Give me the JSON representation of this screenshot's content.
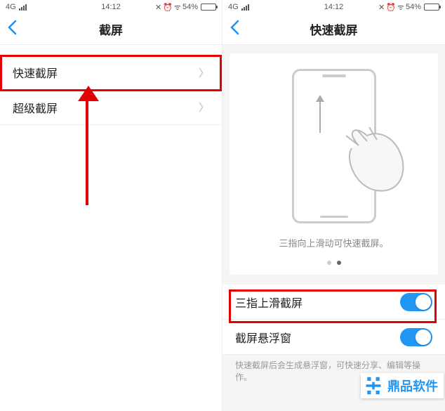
{
  "status": {
    "netLabel": "4G",
    "time": "14:12",
    "batteryPct": "54%",
    "wifiGlyph": "ᯤ",
    "alarmGlyph": "⏰",
    "vibGlyph": "✕"
  },
  "left": {
    "title": "截屏",
    "rows": [
      {
        "label": "快速截屏"
      },
      {
        "label": "超级截屏"
      }
    ]
  },
  "right": {
    "title": "快速截屏",
    "illusCaption": "三指向上滑动可快速截屏。",
    "toggle1Label": "三指上滑截屏",
    "toggle2Label": "截屏悬浮窗",
    "helper": "快速截屏后会生成悬浮窗，可快速分享、编辑等操作。"
  },
  "watermark": "鼎品软件"
}
